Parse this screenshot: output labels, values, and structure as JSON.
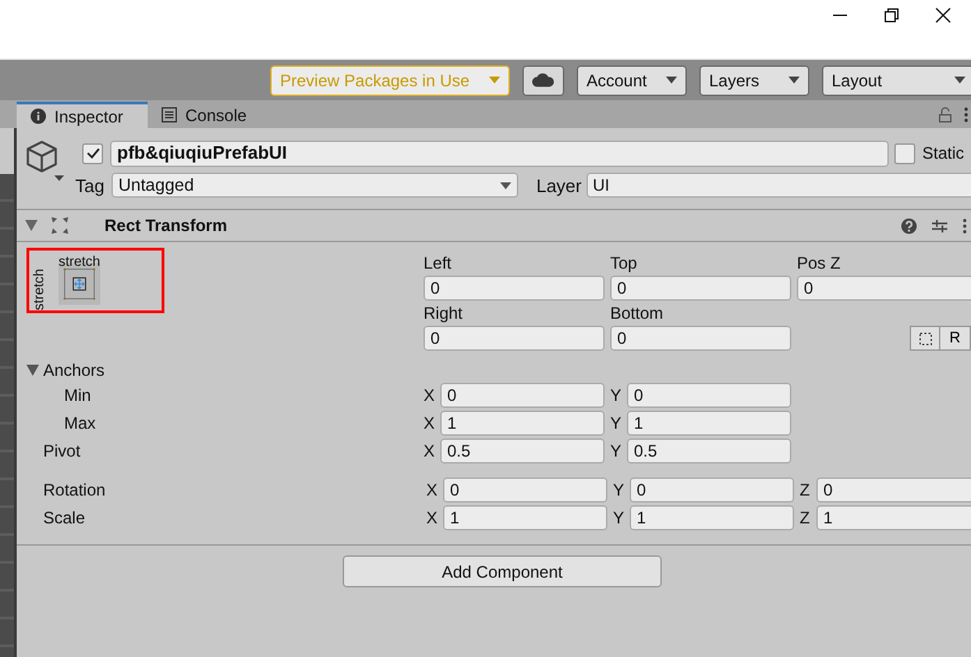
{
  "toolbar": {
    "preview_packages": "Preview Packages in Use",
    "account": "Account",
    "layers": "Layers",
    "layout": "Layout"
  },
  "tabs": [
    {
      "label": "Inspector",
      "selected": true
    },
    {
      "label": "Console",
      "selected": false
    }
  ],
  "game_object": {
    "active": true,
    "name": "pfb&qiuqiuPrefabUI",
    "static_label": "Static",
    "static": false,
    "tag_label": "Tag",
    "tag": "Untagged",
    "layer_label": "Layer",
    "layer": "UI"
  },
  "component": {
    "title": "Rect Transform",
    "expanded": true,
    "anchor_preset": {
      "horizontal": "stretch",
      "vertical": "stretch",
      "highlighted": true
    },
    "position_rows": [
      [
        {
          "label": "Left",
          "value": "0"
        },
        {
          "label": "Top",
          "value": "0"
        },
        {
          "label": "Pos Z",
          "value": "0"
        }
      ],
      [
        {
          "label": "Right",
          "value": "0"
        },
        {
          "label": "Bottom",
          "value": "0"
        }
      ]
    ],
    "raw_edit_button": "R",
    "anchors": {
      "label": "Anchors",
      "expanded": true,
      "rows": [
        {
          "label": "Min",
          "fields": [
            {
              "axis": "X",
              "value": "0"
            },
            {
              "axis": "Y",
              "value": "0"
            }
          ]
        },
        {
          "label": "Max",
          "fields": [
            {
              "axis": "X",
              "value": "1"
            },
            {
              "axis": "Y",
              "value": "1"
            }
          ]
        }
      ]
    },
    "pivot": {
      "label": "Pivot",
      "fields": [
        {
          "axis": "X",
          "value": "0.5"
        },
        {
          "axis": "Y",
          "value": "0.5"
        }
      ]
    },
    "rotation": {
      "label": "Rotation",
      "fields": [
        {
          "axis": "X",
          "value": "0"
        },
        {
          "axis": "Y",
          "value": "0"
        },
        {
          "axis": "Z",
          "value": "0"
        }
      ]
    },
    "scale": {
      "label": "Scale",
      "fields": [
        {
          "axis": "X",
          "value": "1"
        },
        {
          "axis": "Y",
          "value": "1"
        },
        {
          "axis": "Z",
          "value": "1"
        }
      ]
    }
  },
  "add_component": "Add Component"
}
